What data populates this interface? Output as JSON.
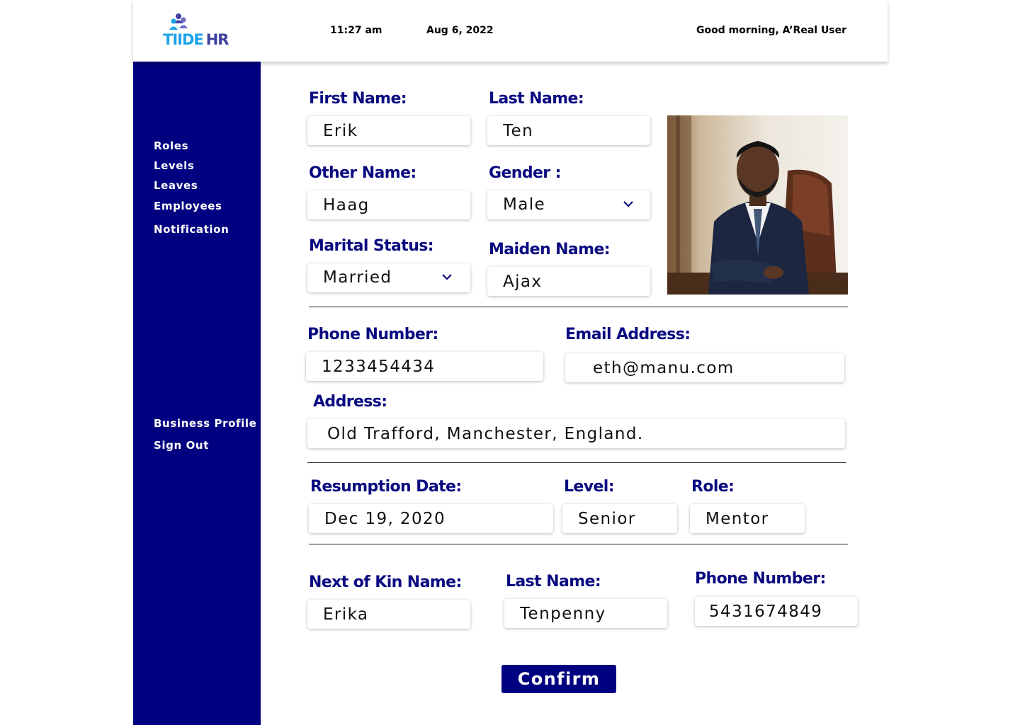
{
  "header": {
    "logo_tiide": "TIIDE",
    "logo_hr": "HR",
    "time": "11:27 am",
    "date": "Aug 6, 2022",
    "greeting": "Good morning, A’Real User"
  },
  "sidebar": {
    "items": [
      {
        "label": "Roles"
      },
      {
        "label": "Levels"
      },
      {
        "label": "Leaves"
      },
      {
        "label": "Employees"
      },
      {
        "label": "Notification"
      }
    ],
    "bottom_items": [
      {
        "label": "Business Profile"
      },
      {
        "label": "Sign Out"
      }
    ]
  },
  "form": {
    "first_name": {
      "label": "First Name:",
      "value": "Erik"
    },
    "last_name": {
      "label": "Last Name:",
      "value": "Ten"
    },
    "other_name": {
      "label": "Other Name:",
      "value": "Haag"
    },
    "gender": {
      "label": "Gender :",
      "value": "Male"
    },
    "marital_status": {
      "label": "Marital Status:",
      "value": "Married"
    },
    "maiden_name": {
      "label": "Maiden Name:",
      "value": "Ajax"
    },
    "phone": {
      "label": "Phone Number:",
      "value": "1233454434"
    },
    "email": {
      "label": "Email Address:",
      "value": "eth@manu.com"
    },
    "address": {
      "label": "Address:",
      "value": "Old Trafford, Manchester, England."
    },
    "resumption_date": {
      "label": "Resumption Date:",
      "value": "Dec 19, 2020"
    },
    "level": {
      "label": "Level:",
      "value": "Senior"
    },
    "role": {
      "label": "Role:",
      "value": "Mentor"
    },
    "kin_name": {
      "label": "Next of Kin  Name:",
      "value": "Erika"
    },
    "kin_last_name": {
      "label": "Last Name:",
      "value": "Tenpenny"
    },
    "kin_phone": {
      "label": "Phone Number:",
      "value": "5431674849"
    }
  },
  "confirm_label": "Confirm",
  "colors": {
    "sidebar_bg": "#000080",
    "label_text": "#0a0a80",
    "logo_tiide": "#1aa3e8",
    "logo_hr": "#3f3fa0",
    "button_bg": "#000080"
  }
}
